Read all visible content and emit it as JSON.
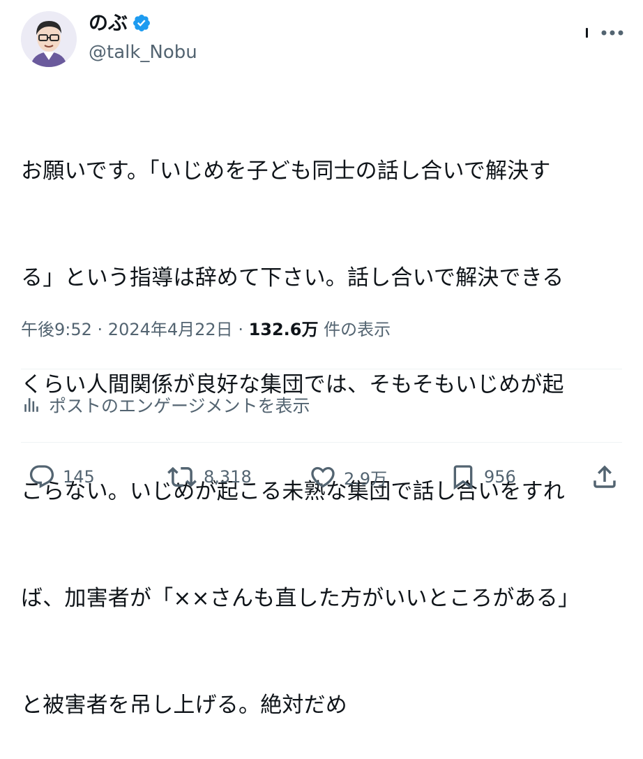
{
  "user": {
    "display_name": "のぶ",
    "handle": "@talk_Nobu",
    "verified": true,
    "avatar_icon": "avatar-illustration"
  },
  "tweet": {
    "lines": [
      "お願いです。「いじめを子ども同士の話し合いで解決す",
      "る」という指導は辞めて下さい。話し合いで解決できる",
      "くらい人間関係が良好な集団では、そもそもいじめが起",
      "こらない。いじめが起こる未熟な集団で話し合いをすれ",
      "ば、加害者が「××さんも直した方がいいところがある」",
      "と被害者を吊し上げる。絶対だめ"
    ]
  },
  "meta": {
    "time": "午後9:52",
    "sep1": " · ",
    "date": "2024年4月22日",
    "sep2": " · ",
    "views_count": "132.6万",
    "views_label": " 件の表示"
  },
  "engagements_label": "ポストのエンゲージメントを表示",
  "actions": {
    "reply_count": "145",
    "repost_count": "8,318",
    "like_count": "2.9万",
    "bookmark_count": "956"
  },
  "colors": {
    "text": "#0f1419",
    "muted": "#536471",
    "verified_badge": "#1d9bf0",
    "divider": "#eff3f4"
  },
  "icons": [
    "verified-badge-icon",
    "more-icon",
    "analytics-icon",
    "reply-icon",
    "repost-icon",
    "like-icon",
    "bookmark-icon",
    "share-icon"
  ]
}
